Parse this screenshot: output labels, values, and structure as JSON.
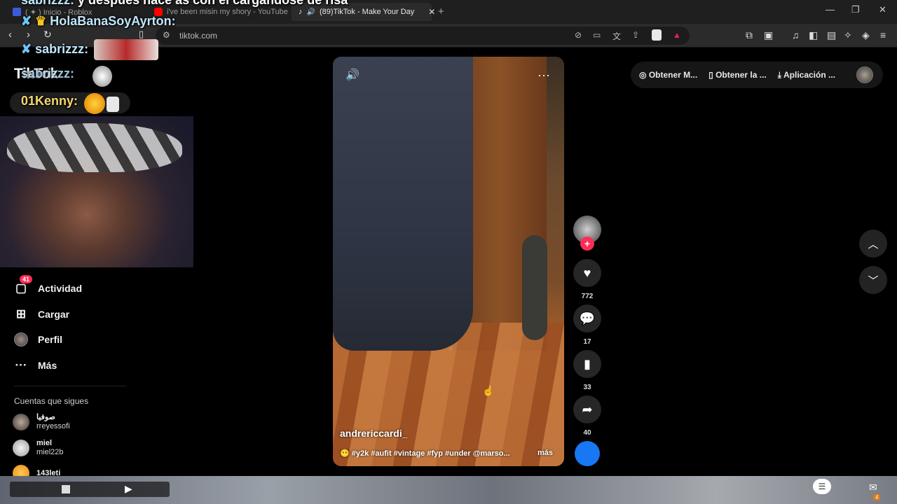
{
  "browser": {
    "tabs": [
      {
        "title": "( ✦ ) Inicio - Roblox",
        "icon": "roblox-icon",
        "color": "#3a5bd9"
      },
      {
        "title": "i've been misin my shory - YouTube",
        "icon": "youtube-icon",
        "color": "#ff0000"
      },
      {
        "title": "(89)TikTok - Make Your Day",
        "icon": "tiktok-icon",
        "color": "#ffffff"
      }
    ],
    "url": "tiktok.com",
    "window_controls": [
      "—",
      "❐",
      "✕"
    ]
  },
  "chat_overlay": [
    {
      "user": "sabrizzz:",
      "message": "y después hace as con el cargándose de risa"
    },
    {
      "user": "HolaBanaSoyAyrton:",
      "message": ""
    },
    {
      "user": "sabrizzz:",
      "message": ""
    },
    {
      "user": "sabrizzz:",
      "message": ""
    },
    {
      "user": "01Kenny:",
      "message": ""
    }
  ],
  "sidebar": {
    "logo": "TikTok",
    "items": [
      {
        "label": "Actividad",
        "icon": "inbox-icon",
        "badge": "41"
      },
      {
        "label": "Cargar",
        "icon": "upload-icon"
      },
      {
        "label": "Perfil",
        "icon": "avatar"
      },
      {
        "label": "Más",
        "icon": "more-icon"
      }
    ],
    "following_title": "Cuentas que sigues",
    "following": [
      {
        "display": "صوفيا",
        "handle": "rreyessofi"
      },
      {
        "display": "miel",
        "handle": "miel22b"
      },
      {
        "display": "143leti",
        "handle": ""
      }
    ]
  },
  "video": {
    "author": "andrericcardi_",
    "description": "😶 #y2k #aufit #vintage #fyp #under @marso...",
    "more": "más",
    "actions": {
      "likes": "772",
      "comments": "17",
      "saves": "33",
      "shares": "40"
    }
  },
  "topbar": {
    "items": [
      "Obtener M...",
      "Obtener la ...",
      "Aplicación ..."
    ]
  },
  "colors": {
    "accent": "#fe2c55",
    "background": "#000000"
  }
}
